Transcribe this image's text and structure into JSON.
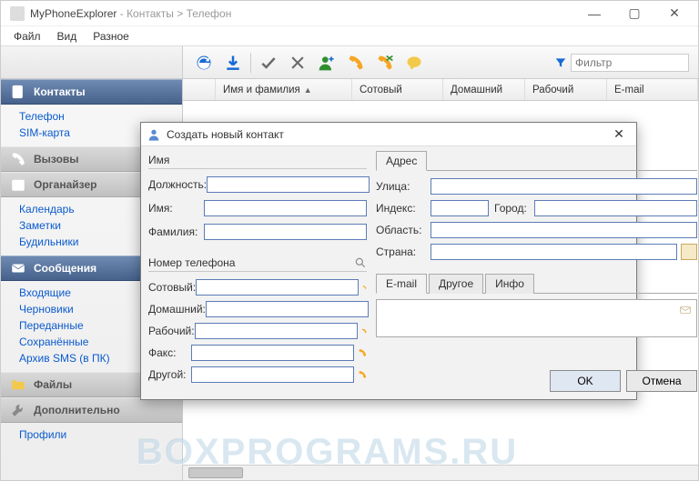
{
  "window": {
    "app": "MyPhoneExplorer",
    "separator": " - ",
    "breadcrumb": "Контакты > Телефон"
  },
  "menu": {
    "file": "Файл",
    "view": "Вид",
    "misc": "Разное"
  },
  "toolbar": {
    "icons": [
      "refresh",
      "download",
      "check",
      "cut",
      "add-user",
      "call",
      "call-swap",
      "chat"
    ],
    "filter_placeholder": "Фильтр"
  },
  "columns": {
    "blank": "",
    "name": "Имя и фамилия",
    "mobile": "Сотовый",
    "home": "Домашний",
    "work": "Рабочий",
    "email": "E-mail"
  },
  "sidebar": {
    "contacts": {
      "title": "Контакты",
      "items": [
        {
          "label": "Телефон",
          "active": true
        },
        {
          "label": "SIM-карта"
        }
      ]
    },
    "calls": {
      "title": "Вызовы",
      "items": []
    },
    "organizer": {
      "title": "Органайзер",
      "items": [
        {
          "label": "Календарь"
        },
        {
          "label": "Заметки"
        },
        {
          "label": "Будильники"
        }
      ]
    },
    "messages": {
      "title": "Сообщения",
      "items": [
        {
          "label": "Входящие"
        },
        {
          "label": "Черновики"
        },
        {
          "label": "Переданные"
        },
        {
          "label": "Сохранённые"
        },
        {
          "label": "Архив SMS (в ПК)"
        }
      ]
    },
    "files": {
      "title": "Файлы",
      "items": []
    },
    "extra": {
      "title": "Дополнительно",
      "items": [
        {
          "label": "Профили"
        }
      ]
    }
  },
  "dialog": {
    "title": "Создать новый контакт",
    "ok": "OK",
    "cancel": "Отмена",
    "name_group": "Имя",
    "position": "Должность:",
    "firstname": "Имя:",
    "lastname": "Фамилия:",
    "phone_group": "Номер телефона",
    "mobile": "Сотовый:",
    "home": "Домашний:",
    "work": "Рабочий:",
    "fax": "Факс:",
    "other": "Другой:",
    "tab_address": "Адрес",
    "street": "Улица:",
    "index": "Индекс:",
    "city": "Город:",
    "region": "Область:",
    "country": "Страна:",
    "tab_email": "E-mail",
    "tab_other": "Другое",
    "tab_info": "Инфо"
  },
  "watermark": "BOXPROGRAMS.RU"
}
